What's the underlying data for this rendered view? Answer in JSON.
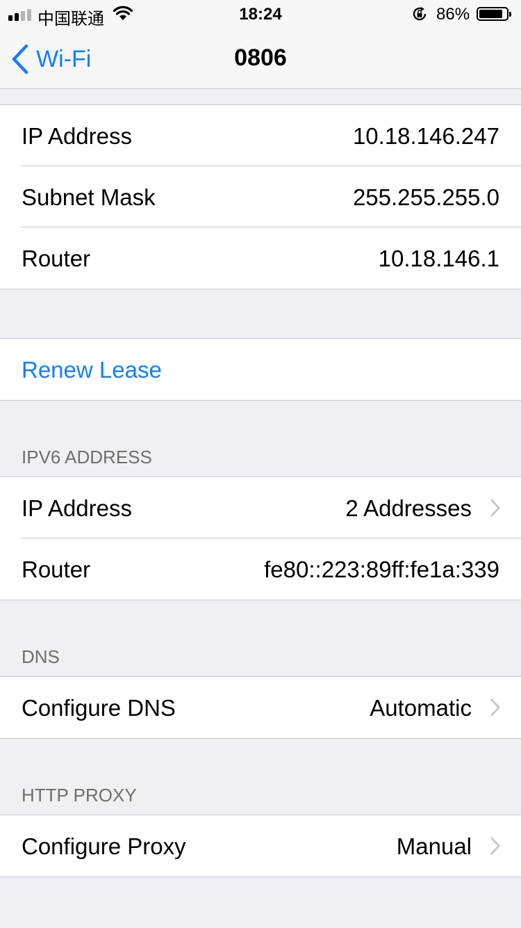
{
  "status_bar": {
    "carrier": "中国联通",
    "time": "18:24",
    "battery_percent": "86%",
    "battery_level": 0.86
  },
  "nav": {
    "back_label": "Wi-Fi",
    "title": "0806"
  },
  "ipv4": {
    "rows": [
      {
        "label": "IP Address",
        "value": "10.18.146.247"
      },
      {
        "label": "Subnet Mask",
        "value": "255.255.255.0"
      },
      {
        "label": "Router",
        "value": "10.18.146.1"
      }
    ]
  },
  "renew": {
    "label": "Renew Lease"
  },
  "ipv6": {
    "header": "IPV6 ADDRESS",
    "rows": [
      {
        "label": "IP Address",
        "value": "2 Addresses"
      },
      {
        "label": "Router",
        "value": "fe80::223:89ff:fe1a:339"
      }
    ]
  },
  "dns": {
    "header": "DNS",
    "label": "Configure DNS",
    "value": "Automatic"
  },
  "proxy": {
    "header": "HTTP PROXY",
    "label": "Configure Proxy",
    "value": "Manual"
  },
  "colors": {
    "accent": "#157efb",
    "background": "#efeff4",
    "separator": "#c8c7cc",
    "header_text": "#6d6d72",
    "chevron": "#c7c7cc"
  }
}
